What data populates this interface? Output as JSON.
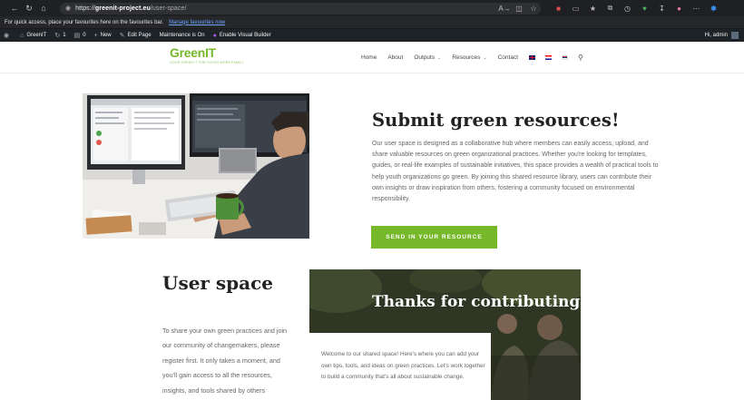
{
  "browser": {
    "url_scheme": "https://",
    "url_host": "greenit-project.eu",
    "url_path": "/user-space/",
    "reader_icon": "A→",
    "icons": [
      "back-arrow-icon",
      "refresh-icon",
      "home-icon",
      "lock-icon",
      "reader-icon",
      "split-screen-icon",
      "favorite-star-icon",
      "extension-icon",
      "sidebar-icon",
      "favorites-icon",
      "collections-icon",
      "history-icon",
      "performance-icon",
      "downloads-icon",
      "profile-icon",
      "copilot-icon"
    ]
  },
  "favorites_bar": {
    "message": "For quick access, place your favourites here on the favourites bar.",
    "link": "Manage favourites now"
  },
  "admin_bar": {
    "site_name": "GreenIT",
    "updates_count": "1",
    "comments_count": "0",
    "new_label": "New",
    "edit_label": "Edit Page",
    "maintenance_label": "Maintenance is On",
    "builder_label": "Enable Visual Builder",
    "greeting": "Hi, admin"
  },
  "header": {
    "logo_main": "GreenIT",
    "logo_tagline": "GOOD GREEN IT FOR YOUTH WORK FAMILY",
    "menu": [
      {
        "label": "Home",
        "dropdown": false
      },
      {
        "label": "About",
        "dropdown": false
      },
      {
        "label": "Outputs",
        "dropdown": true
      },
      {
        "label": "Resources",
        "dropdown": true
      },
      {
        "label": "Contact",
        "dropdown": false
      }
    ],
    "languages": [
      "en",
      "hr",
      "sr"
    ]
  },
  "submit": {
    "title": "Submit green resources!",
    "body": "Our user space is designed as a collaborative hub where members can easily access, upload, and share valuable resources on green organizational practices. Whether you're looking for templates, guides, or real-life examples of sustainable initiatives, this space provides a wealth of practical tools to help youth organizations go green. By joining this shared resource library, users can contribute their own insights or draw inspiration from others, fostering a community focused on environmental responsibility.",
    "button": "SEND IN YOUR RESOURCE"
  },
  "user_space": {
    "title": "User space",
    "body": "To share your own green practices and join our community of changemakers, please register first. It only takes a moment, and you'll gain access to all the resources, insights, and tools shared by others committed"
  },
  "thanks": {
    "title": "Thanks for contributing!",
    "body": "Welcome to our shared space! Here's where you can add your own tips, tools, and ideas on green practices. Let's work together to build a community that's all about sustainable change."
  },
  "colors": {
    "accent_green": "#76b82a",
    "admin_bar": "#1d2327",
    "browser_bar": "#1f2023"
  }
}
